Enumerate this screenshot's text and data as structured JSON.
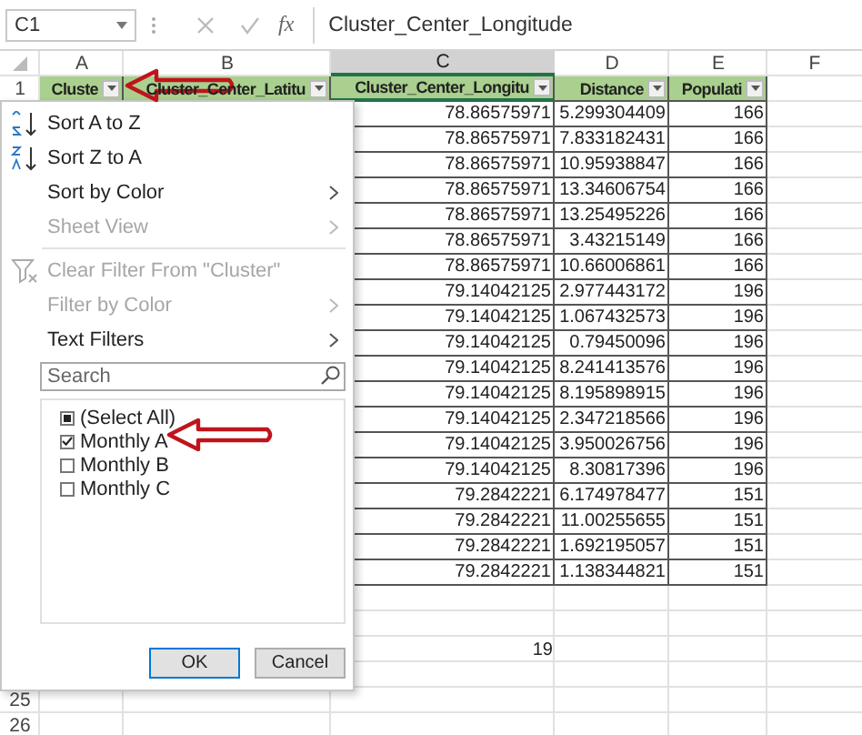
{
  "formula_bar": {
    "name_box": "C1",
    "function_label": "fx",
    "formula": "Cluster_Center_Longitude"
  },
  "columns": [
    {
      "label": "A",
      "selected": false
    },
    {
      "label": "B",
      "selected": false
    },
    {
      "label": "C",
      "selected": true
    },
    {
      "label": "D",
      "selected": false
    },
    {
      "label": "E",
      "selected": false
    },
    {
      "label": "F",
      "selected": false
    }
  ],
  "header_row": {
    "number": "1",
    "cells": [
      {
        "text": "Cluste",
        "filter": true
      },
      {
        "text": "Cluster_Center_Latitu",
        "filter": true
      },
      {
        "text": "Cluster_Center_Longitu",
        "filter": true
      },
      {
        "text": "Distance",
        "filter": true
      },
      {
        "text": "Populati",
        "filter": true
      }
    ]
  },
  "rows": [
    {
      "kind": "table",
      "c": "78.86575971",
      "d": "5.299304409",
      "e": "166"
    },
    {
      "kind": "table",
      "c": "78.86575971",
      "d": "7.833182431",
      "e": "166"
    },
    {
      "kind": "table",
      "c": "78.86575971",
      "d": "10.95938847",
      "e": "166"
    },
    {
      "kind": "table",
      "c": "78.86575971",
      "d": "13.34606754",
      "e": "166"
    },
    {
      "kind": "table",
      "c": "78.86575971",
      "d": "13.25495226",
      "e": "166"
    },
    {
      "kind": "table",
      "c": "78.86575971",
      "d": "3.43215149",
      "e": "166"
    },
    {
      "kind": "table",
      "c": "78.86575971",
      "d": "10.66006861",
      "e": "166"
    },
    {
      "kind": "table",
      "c": "79.14042125",
      "d": "2.977443172",
      "e": "196"
    },
    {
      "kind": "table",
      "c": "79.14042125",
      "d": "1.067432573",
      "e": "196"
    },
    {
      "kind": "table",
      "c": "79.14042125",
      "d": "0.79450096",
      "e": "196"
    },
    {
      "kind": "table",
      "c": "79.14042125",
      "d": "8.241413576",
      "e": "196"
    },
    {
      "kind": "table",
      "c": "79.14042125",
      "d": "8.195898915",
      "e": "196"
    },
    {
      "kind": "table",
      "c": "79.14042125",
      "d": "2.347218566",
      "e": "196"
    },
    {
      "kind": "table",
      "c": "79.14042125",
      "d": "3.950026756",
      "e": "196"
    },
    {
      "kind": "table",
      "c": "79.14042125",
      "d": "8.30817396",
      "e": "196"
    },
    {
      "kind": "table",
      "c": "79.2842221",
      "d": "6.174978477",
      "e": "151"
    },
    {
      "kind": "table",
      "c": "79.2842221",
      "d": "11.00255655",
      "e": "151"
    },
    {
      "kind": "table",
      "c": "79.2842221",
      "d": "1.692195057",
      "e": "151"
    },
    {
      "kind": "table",
      "c": "79.2842221",
      "d": "1.138344821",
      "e": "151"
    },
    {
      "kind": "plain"
    },
    {
      "kind": "plain"
    },
    {
      "kind": "plain",
      "c": "19"
    },
    {
      "kind": "plain"
    },
    {
      "kind": "plain",
      "number": "25"
    },
    {
      "kind": "plain",
      "number": "26"
    }
  ],
  "filter_menu": {
    "items": [
      {
        "kind": "sort-asc",
        "label": "Sort A to Z",
        "disabled": false,
        "submenu": false
      },
      {
        "kind": "sort-desc",
        "label": "Sort Z to A",
        "disabled": false,
        "submenu": false
      },
      {
        "kind": "plain",
        "label": "Sort by Color",
        "disabled": false,
        "submenu": true
      },
      {
        "kind": "plain",
        "label": "Sheet View",
        "disabled": true,
        "submenu": true
      },
      {
        "kind": "divider"
      },
      {
        "kind": "clear-filter",
        "label": "Clear Filter From \"Cluster\"",
        "disabled": true,
        "submenu": false
      },
      {
        "kind": "plain",
        "label": "Filter by Color",
        "disabled": true,
        "submenu": true
      },
      {
        "kind": "plain",
        "label": "Text Filters",
        "disabled": false,
        "submenu": true
      }
    ],
    "search": {
      "placeholder": "Search"
    },
    "values": [
      {
        "label": "(Select All)",
        "checked": false,
        "partial": true
      },
      {
        "label": "Monthly A",
        "checked": true,
        "partial": false
      },
      {
        "label": "Monthly B",
        "checked": false,
        "partial": false
      },
      {
        "label": "Monthly C",
        "checked": false,
        "partial": false
      }
    ],
    "buttons": [
      {
        "label": "OK",
        "default": true
      },
      {
        "label": "Cancel",
        "default": false
      }
    ]
  }
}
